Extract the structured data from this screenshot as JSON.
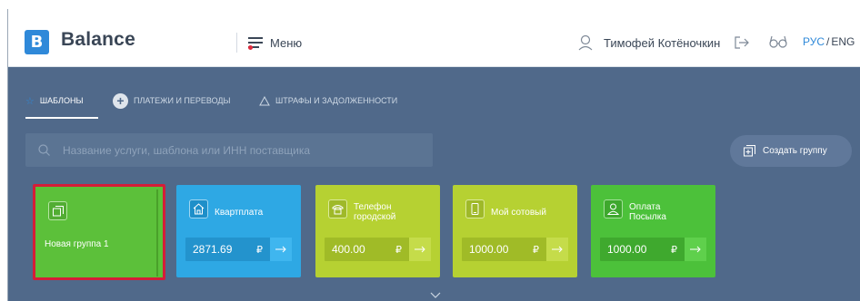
{
  "header": {
    "logo_letter": "B",
    "logo_text": "Balance",
    "menu_label": "Меню",
    "user_name": "Тимофей Котёночкин",
    "lang_ru": "РУС",
    "lang_sep": "/",
    "lang_en": "ENG"
  },
  "tabs": [
    {
      "label": "ШАБЛОНЫ",
      "icon": "star-icon",
      "active": true
    },
    {
      "label": "ПЛАТЕЖИ И ПЕРЕВОДЫ",
      "icon": "plus-circle-icon",
      "active": false
    },
    {
      "label": "ШТРАФЫ И ЗАДОЛЖЕННОСТИ",
      "icon": "warning-icon",
      "active": false
    }
  ],
  "search": {
    "placeholder": "Название услуги, шаблона или ИНН поставщика"
  },
  "create_group_label": "Создать группу",
  "cards": [
    {
      "title": "Новая группа 1",
      "icon": "group-icon",
      "selected": true
    },
    {
      "title": "Квартплата",
      "icon": "house-icon",
      "amount": "2871.69",
      "currency": "₽"
    },
    {
      "title_line1": "Телефон",
      "title_line2": "городской",
      "icon": "phone-icon",
      "amount": "400.00",
      "currency": "₽"
    },
    {
      "title": "Мой сотовый",
      "icon": "mobile-icon",
      "amount": "1000.00",
      "currency": "₽"
    },
    {
      "title_line1": "Оплата",
      "title_line2": "Посылка",
      "icon": "user-icon",
      "amount": "1000.00",
      "currency": "₽"
    }
  ],
  "colors": {
    "background": "#50698a",
    "accent_blue": "#2f89d9",
    "selection_red": "#d51d38"
  }
}
